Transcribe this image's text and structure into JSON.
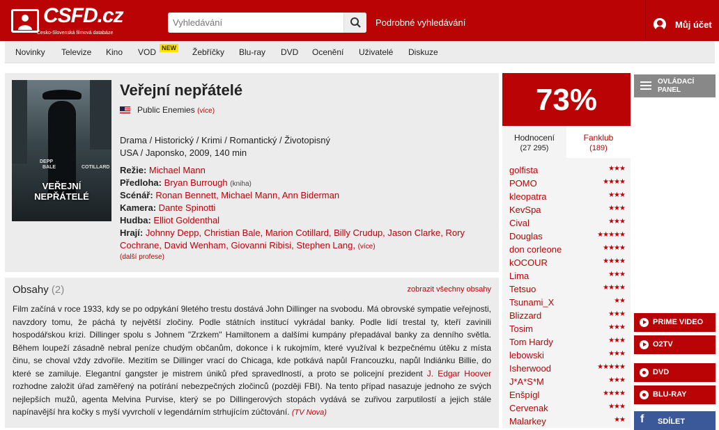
{
  "header": {
    "logo_text": "CSFD.cz",
    "logo_subtitle": "Česko-Slovenská filmová databáze",
    "search_placeholder": "Vyhledávání",
    "advanced_search": "Podrobné vyhledávání",
    "account": "Můj účet"
  },
  "nav": {
    "items": [
      "Novinky",
      "Televize",
      "Kino",
      "VOD",
      "Žebříčky",
      "Blu-ray",
      "DVD",
      "Ocenění",
      "Uživatelé",
      "Diskuze"
    ],
    "vod_badge": "NEW"
  },
  "film": {
    "title": "Veřejní nepřátelé",
    "original_title": "Public Enemies",
    "original_more": "(více)",
    "genres": "Drama / Historický / Krimi / Romantický / Životopisný",
    "origin": "USA / Japonsko, 2009, 140 min",
    "poster": {
      "title_line1": "VEŘEJNÍ",
      "title_line2": "NEPŘÁTELÉ",
      "cast_left": "DEPP",
      "cast_left2": "BALE",
      "cast_right": "COTILLARD"
    },
    "crew": {
      "director_label": "Režie:",
      "director": "Michael Mann",
      "source_label": "Předloha:",
      "source": "Bryan Burrough",
      "source_note": "(kniha)",
      "writers_label": "Scénář:",
      "writers": "Ronan Bennett, Michael Mann, Ann Biderman",
      "camera_label": "Kamera:",
      "camera": "Dante Spinotti",
      "music_label": "Hudba:",
      "music": "Elliot Goldenthal",
      "cast_label": "Hrají:",
      "cast_line1": "Johnny Depp, Christian Bale, Marion Cotillard, Billy Crudup, Jason Clarke, Rory",
      "cast_line2": "Cochrane, David Wenham, Giovanni Ribisi, Stephen Lang,",
      "cast_more": "(více)",
      "more_professions": "(další profese)"
    }
  },
  "plot": {
    "heading": "Obsahy",
    "count": "(2)",
    "show_all": "zobrazit všechny obsahy",
    "text_before": "Film začíná v roce 1933, kdy se po odpykání 9letého trestu dostává John Dillinger na svobodu. Má obrovské sympatie veřejnosti, navzdory tomu, že páchá ty největší zločiny. Podle státních institucí vykrádal banky. Podle lidí trestal ty, kteří zavinili hospodářskou krizi. Dillinger spolu s Johnem \"Zrzkem\" Hamiltonem a dalšími kumpány přepadával banky za denního světla. Během loupeží zásadně nebral peníze chudým občanům, dokonce i k rukojmím, které využíval k bezpečnému útěku z místa činu, se choval vždy zdvořile. Mezitím se Dillinger vrací do Chicaga, kde potkává napůl Francouzku, napůl Indiánku Billie, do které se zamiluje. Elegantní gangster je mistrem úniků před spravedlností, a proto se policejní prezident ",
    "link": "J. Edgar Hoover",
    "text_after": " rozhodne založit úřad zaměřený na potírání nebezpečných zločinců (později FBI). Na tento případ nasazuje jednoho ze svých nejlepších mužů, agenta Melvina Purvise, který se po Dillingerových stopách vydává se zuřivou zarputilostí a jejich stále napínavější hra kočky s myší vyvrcholí v legendárním strhujícím zúčtování.",
    "source": "(TV Nova)"
  },
  "rating": {
    "score": "73%",
    "tab_ratings": "Hodnocení",
    "tab_ratings_count": "(27 295)",
    "tab_fanclub": "Fanklub",
    "tab_fanclub_count": "(189)",
    "users": [
      {
        "name": "golfista",
        "stars": 3
      },
      {
        "name": "POMO",
        "stars": 4
      },
      {
        "name": "kleopatra",
        "stars": 3
      },
      {
        "name": "KevSpa",
        "stars": 3
      },
      {
        "name": "Cival",
        "stars": 3
      },
      {
        "name": "Douglas",
        "stars": 5
      },
      {
        "name": "don corleone",
        "stars": 4
      },
      {
        "name": "kOCOUR",
        "stars": 4
      },
      {
        "name": "Lima",
        "stars": 3
      },
      {
        "name": "Tetsuo",
        "stars": 4
      },
      {
        "name": "Tsunami_X",
        "stars": 2
      },
      {
        "name": "Blizzard",
        "stars": 3
      },
      {
        "name": "Tosim",
        "stars": 3
      },
      {
        "name": "Tom Hardy",
        "stars": 3
      },
      {
        "name": "lebowski",
        "stars": 3
      },
      {
        "name": "Isherwood",
        "stars": 5
      },
      {
        "name": "J*A*S*M",
        "stars": 3
      },
      {
        "name": "Enšpígl",
        "stars": 4
      },
      {
        "name": "Cervenak",
        "stars": 3
      },
      {
        "name": "Malarkey",
        "stars": 2
      }
    ]
  },
  "sidebar": {
    "panel": "OVLÁDACÍ PANEL",
    "prime_video": "PRIME VIDEO",
    "o2tv": "O2TV",
    "dvd": "DVD",
    "bluray": "BLU-RAY",
    "share": "SDÍLET",
    "share_icon": "f"
  }
}
